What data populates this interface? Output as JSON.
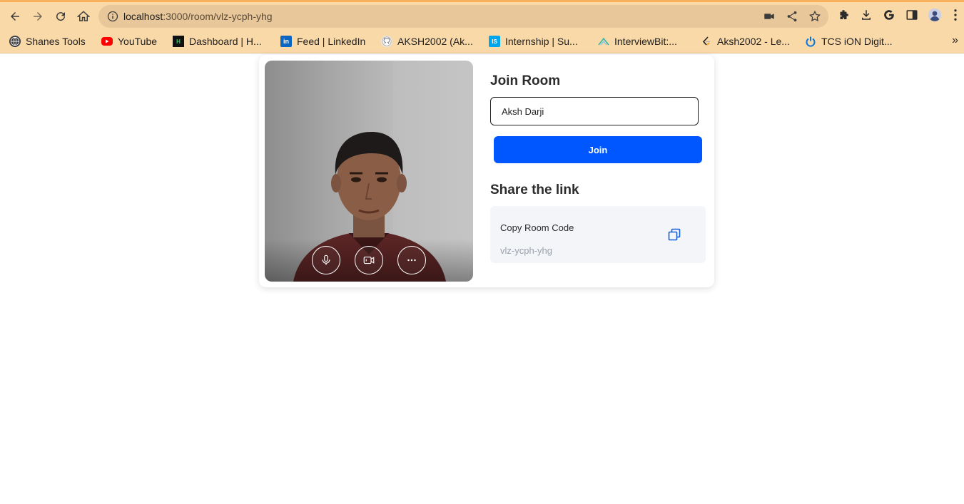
{
  "browser": {
    "url_host": "localhost",
    "url_path": ":3000/room/vlz-ycph-yhg",
    "icons": [
      "back-icon",
      "forward-icon",
      "reload-icon",
      "home-icon",
      "site-info-icon",
      "camera-icon",
      "share-icon",
      "bookmark-star-icon",
      "extensions-icon",
      "download-icon",
      "google-icon",
      "side-panel-icon",
      "profile-avatar",
      "menu-icon"
    ]
  },
  "bookmarks": [
    {
      "label": "Shanes Tools",
      "icon": "globe-icon",
      "color": "#3a3a3a"
    },
    {
      "label": "YouTube",
      "icon": "youtube-icon",
      "color": "#ff0000"
    },
    {
      "label": "Dashboard | H...",
      "icon": "hackerrank-icon",
      "color": "#111111"
    },
    {
      "label": "Feed | LinkedIn",
      "icon": "linkedin-icon",
      "color": "#0a66c2"
    },
    {
      "label": "AKSH2002 (Ak...",
      "icon": "github-icon",
      "color": "#333333"
    },
    {
      "label": "Internship | Su...",
      "icon": "internshala-icon",
      "color": "#00a5ec"
    },
    {
      "label": "InterviewBit:...",
      "icon": "interviewbit-icon",
      "color": "#34b7a7"
    },
    {
      "label": "Aksh2002 - Le...",
      "icon": "leetcode-icon",
      "color": "#f89f1b"
    },
    {
      "label": "TCS iON Digit...",
      "icon": "tcs-ion-icon",
      "color": "#0a74d9"
    }
  ],
  "bookmarks_overflow": "»",
  "join": {
    "title": "Join Room",
    "name_value": "Aksh Darji",
    "join_label": "Join"
  },
  "share": {
    "title": "Share the link",
    "copy_label": "Copy Room Code",
    "room_code": "vlz-ycph-yhg"
  },
  "preview_controls": [
    "microphone-icon",
    "video-camera-icon",
    "more-options-icon"
  ],
  "colors": {
    "accent": "#0057ff",
    "chrome": "#fad9a8",
    "omnibox": "#e8c79a"
  }
}
